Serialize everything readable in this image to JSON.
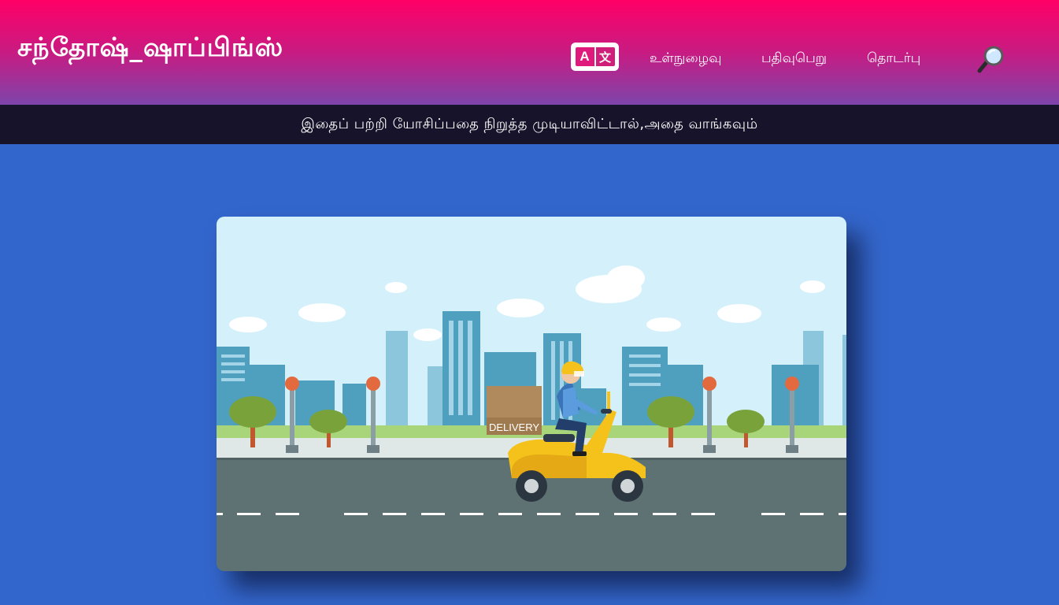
{
  "header": {
    "brand": "சந்தோஷ்_ஷாப்பிங்ஸ்",
    "translate": {
      "letter_a": "A",
      "letter_b": "文"
    },
    "nav": [
      {
        "label": "உள்நுழைவு"
      },
      {
        "label": "பதிவுபெறு"
      },
      {
        "label": "தொடர்பு"
      }
    ],
    "search_icon": "magnifying-glass-icon"
  },
  "banner": {
    "tagline": "இதைப் பற்றி யோசிப்பதை நிறுத்த முடியாவிட்டால்,அதை வாங்கவும்"
  },
  "hero": {
    "box_label": "DELIVERY"
  },
  "colors": {
    "header_top": "#ff0066",
    "header_bottom": "#7d45ab",
    "tagline_bg": "#16132a",
    "page_bg": "#3366cc"
  }
}
